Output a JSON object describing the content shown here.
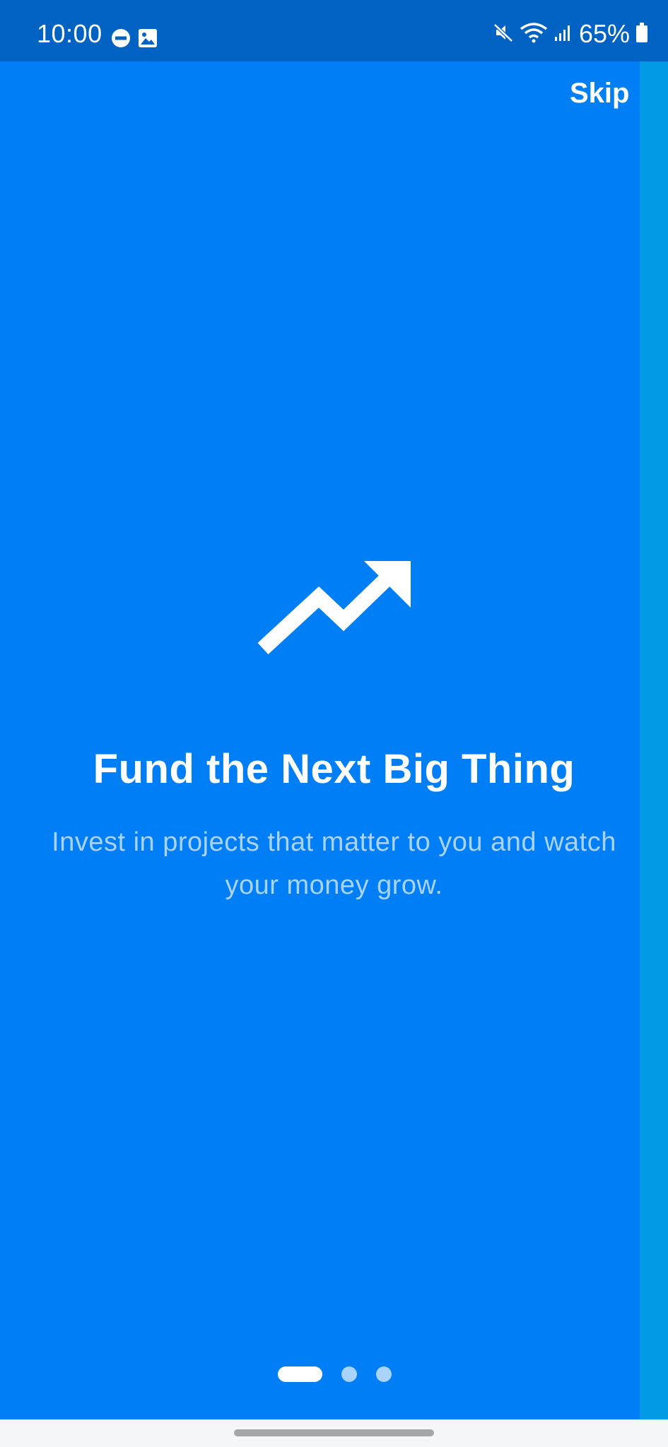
{
  "status_bar": {
    "time": "10:00",
    "battery": "65%",
    "left_icons": [
      "do-not-disturb-icon",
      "gallery-icon"
    ],
    "right_icons": [
      "mute-icon",
      "wifi-icon",
      "signal-icon",
      "battery-icon"
    ]
  },
  "header": {
    "skip_label": "Skip"
  },
  "onboarding": {
    "icon": "trending-up-icon",
    "title": "Fund the Next Big Thing",
    "description": "Invest in projects that matter to you and watch your money grow."
  },
  "page_indicator": {
    "total_pages": 3,
    "current_page": 1
  },
  "colors": {
    "background": "#007ef5",
    "status_bar": "#0062c2",
    "accent_strip": "#019be5",
    "text_primary": "#ffffff",
    "text_secondary": "#a9d3fb"
  }
}
